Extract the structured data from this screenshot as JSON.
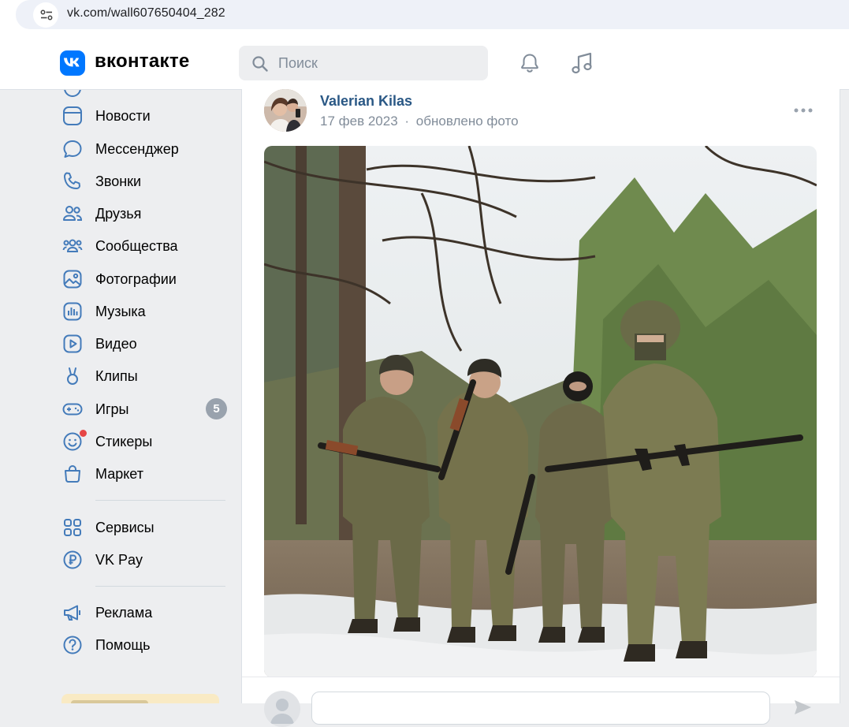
{
  "browser": {
    "url": "vk.com/wall607650404_282"
  },
  "header": {
    "brand": "вконтакте",
    "search_placeholder": "Поиск"
  },
  "nav": {
    "items": [
      {
        "label": "Новости",
        "icon": "news-icon"
      },
      {
        "label": "Мессенджер",
        "icon": "messenger-icon"
      },
      {
        "label": "Звонки",
        "icon": "phone-icon"
      },
      {
        "label": "Друзья",
        "icon": "friends-icon"
      },
      {
        "label": "Сообщества",
        "icon": "communities-icon"
      },
      {
        "label": "Фотографии",
        "icon": "photos-icon"
      },
      {
        "label": "Музыка",
        "icon": "music-icon"
      },
      {
        "label": "Видео",
        "icon": "video-icon"
      },
      {
        "label": "Клипы",
        "icon": "clips-icon"
      },
      {
        "label": "Игры",
        "icon": "games-icon",
        "badge": "5"
      },
      {
        "label": "Стикеры",
        "icon": "stickers-icon"
      },
      {
        "label": "Маркет",
        "icon": "market-icon"
      },
      {
        "label": "Сервисы",
        "icon": "services-icon"
      },
      {
        "label": "VK Pay",
        "icon": "vkpay-icon"
      },
      {
        "label": "Реклама",
        "icon": "ads-icon"
      },
      {
        "label": "Помощь",
        "icon": "help-icon"
      }
    ]
  },
  "post": {
    "author": "Valerian Kilas",
    "date": "17 фев 2023",
    "separator": "·",
    "action": "обновлено фото"
  },
  "colors": {
    "accent": "#0077ff",
    "link": "#2a5885",
    "muted": "#818c99",
    "page_bg": "#edeef0"
  }
}
